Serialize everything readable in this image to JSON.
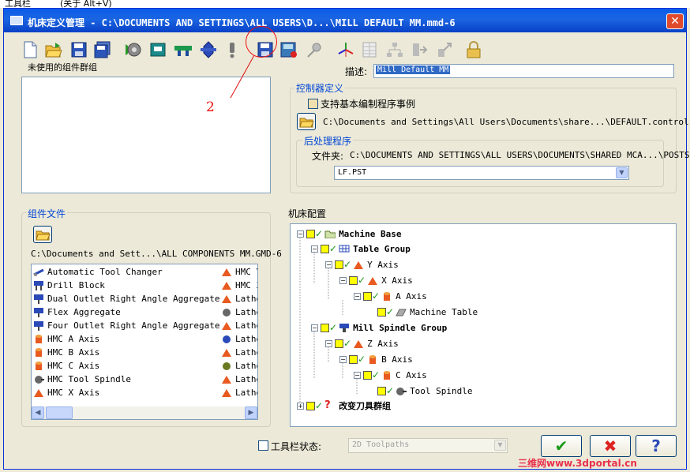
{
  "top_strip": {
    "menu_left": "工具栏",
    "menu_right": "(关于 Alt+V)"
  },
  "window": {
    "title": "机床定义管理 - C:\\DOCUMENTS AND SETTINGS\\ALL USERS\\D...\\MILL DEFAULT MM.mmd-6",
    "close_label": "✕"
  },
  "toolbar": {
    "buttons": [
      "new-file-icon",
      "open-folder-icon",
      "save-icon",
      "save-as-icon",
      "machine-component-icon",
      "table-component-icon",
      "green-component-icon",
      "blue-axis-icon",
      "warning-exclamation-icon",
      "save-control-icon",
      "save-machine-icon",
      "pin-tool-icon",
      "axis-triad-icon",
      "grid-icon",
      "tree-structure-icon",
      "export-icon",
      "disabled-export-icon",
      "lock-icon"
    ]
  },
  "annotation": {
    "number": "2",
    "color": "#e11111"
  },
  "unused_groups": {
    "label": "未使用的组件群组"
  },
  "description": {
    "label": "描述:",
    "value": "Mill Default MM"
  },
  "controller": {
    "group_label": "控制器定义",
    "checkbox_label": "支持基本编制程序事例",
    "checkbox_checked": false,
    "path": "C:\\Documents and Settings\\All Users\\Documents\\share...\\DEFAULT.control-6"
  },
  "post": {
    "group_label": "后处理程序",
    "folder_label": "文件夹:",
    "folder_path": "C:\\DOCUMENTS AND SETTINGS\\ALL USERS\\DOCUMENTS\\SHARED MCA...\\POSTS",
    "selected": "LF.PST"
  },
  "component_files": {
    "group_label": "组件文件",
    "path": "C:\\Documents and Sett...\\ALL COMPONENTS MM.GMD-6",
    "left_items": [
      "Automatic Tool Changer",
      "Drill Block",
      "Dual Outlet Right Angle Aggregate",
      "Flex Aggregate",
      "Four Outlet Right Angle Aggregate",
      "HMC A Axis",
      "HMC B Axis",
      "HMC C Axis",
      "HMC Tool Spindle",
      "HMC X Axis"
    ],
    "right_items": [
      "HMC Y",
      "HMC Z",
      "Lathe",
      "Lathe",
      "Lathe",
      "Lathe",
      "Lathe",
      "Lathe",
      "Lathe",
      "Lathe"
    ]
  },
  "machine_config": {
    "group_label": "机床配置",
    "nodes": [
      "Machine Base",
      "Table Group",
      "Y Axis",
      "X Axis",
      "A Axis",
      "Machine Table",
      "Mill Spindle Group",
      "Z Axis",
      "B Axis",
      "C Axis",
      "Tool Spindle",
      "改变刀具群组"
    ]
  },
  "footer": {
    "toolbar_state_label": "工具栏状态:",
    "toolbar_state_checked": false,
    "toolbar_state_value": "2D Toolpaths",
    "ok_icon": "✔",
    "cancel_icon": "✖",
    "help_icon": "?"
  },
  "watermark": "三维网www.3dportal.cn"
}
